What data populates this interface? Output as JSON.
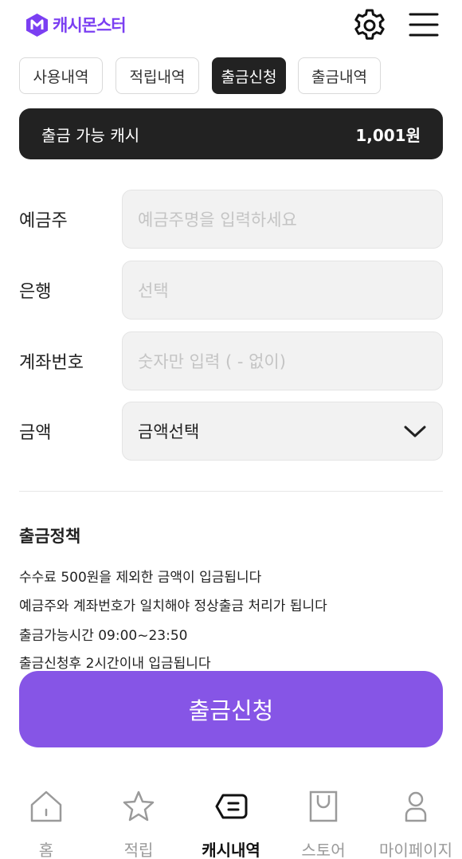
{
  "header": {
    "logo_text": "캐시몬스터",
    "settings_icon": "gear-icon",
    "menu_icon": "hamburger-menu-icon",
    "brand_color": "#7b3ff2"
  },
  "tabs": [
    {
      "label": "사용내역",
      "active": false
    },
    {
      "label": "적립내역",
      "active": false
    },
    {
      "label": "출금신청",
      "active": true
    },
    {
      "label": "출금내역",
      "active": false
    }
  ],
  "balance": {
    "label": "출금 가능 캐시",
    "value": "1,001원"
  },
  "form": {
    "depositor": {
      "label": "예금주",
      "placeholder": "예금주명을 입력하세요",
      "value": ""
    },
    "bank": {
      "label": "은행",
      "placeholder": "선택",
      "value": ""
    },
    "account": {
      "label": "계좌번호",
      "placeholder": "숫자만 입력 ( - 없이)",
      "value": ""
    },
    "amount": {
      "label": "금액",
      "selected": "금액선택"
    }
  },
  "policy": {
    "title": "출금정책",
    "lines": [
      "수수료 500원을 제외한 금액이 입금됩니다",
      "예금주와 계좌번호가 일치해야 정상출금 처리가 됩니다",
      "출금가능시간 09:00~23:50",
      "출금신청후 2시간이내 입금됩니다"
    ]
  },
  "submit_label": "출금신청",
  "accent_color": "#8655e6",
  "bottom_nav": [
    {
      "label": "홈",
      "icon": "home-icon",
      "active": false
    },
    {
      "label": "적립",
      "icon": "star-icon",
      "active": false
    },
    {
      "label": "캐시내역",
      "icon": "chat-history-icon",
      "active": true
    },
    {
      "label": "스토어",
      "icon": "shopping-bag-icon",
      "active": false
    },
    {
      "label": "마이페이지",
      "icon": "user-icon",
      "active": false
    }
  ]
}
